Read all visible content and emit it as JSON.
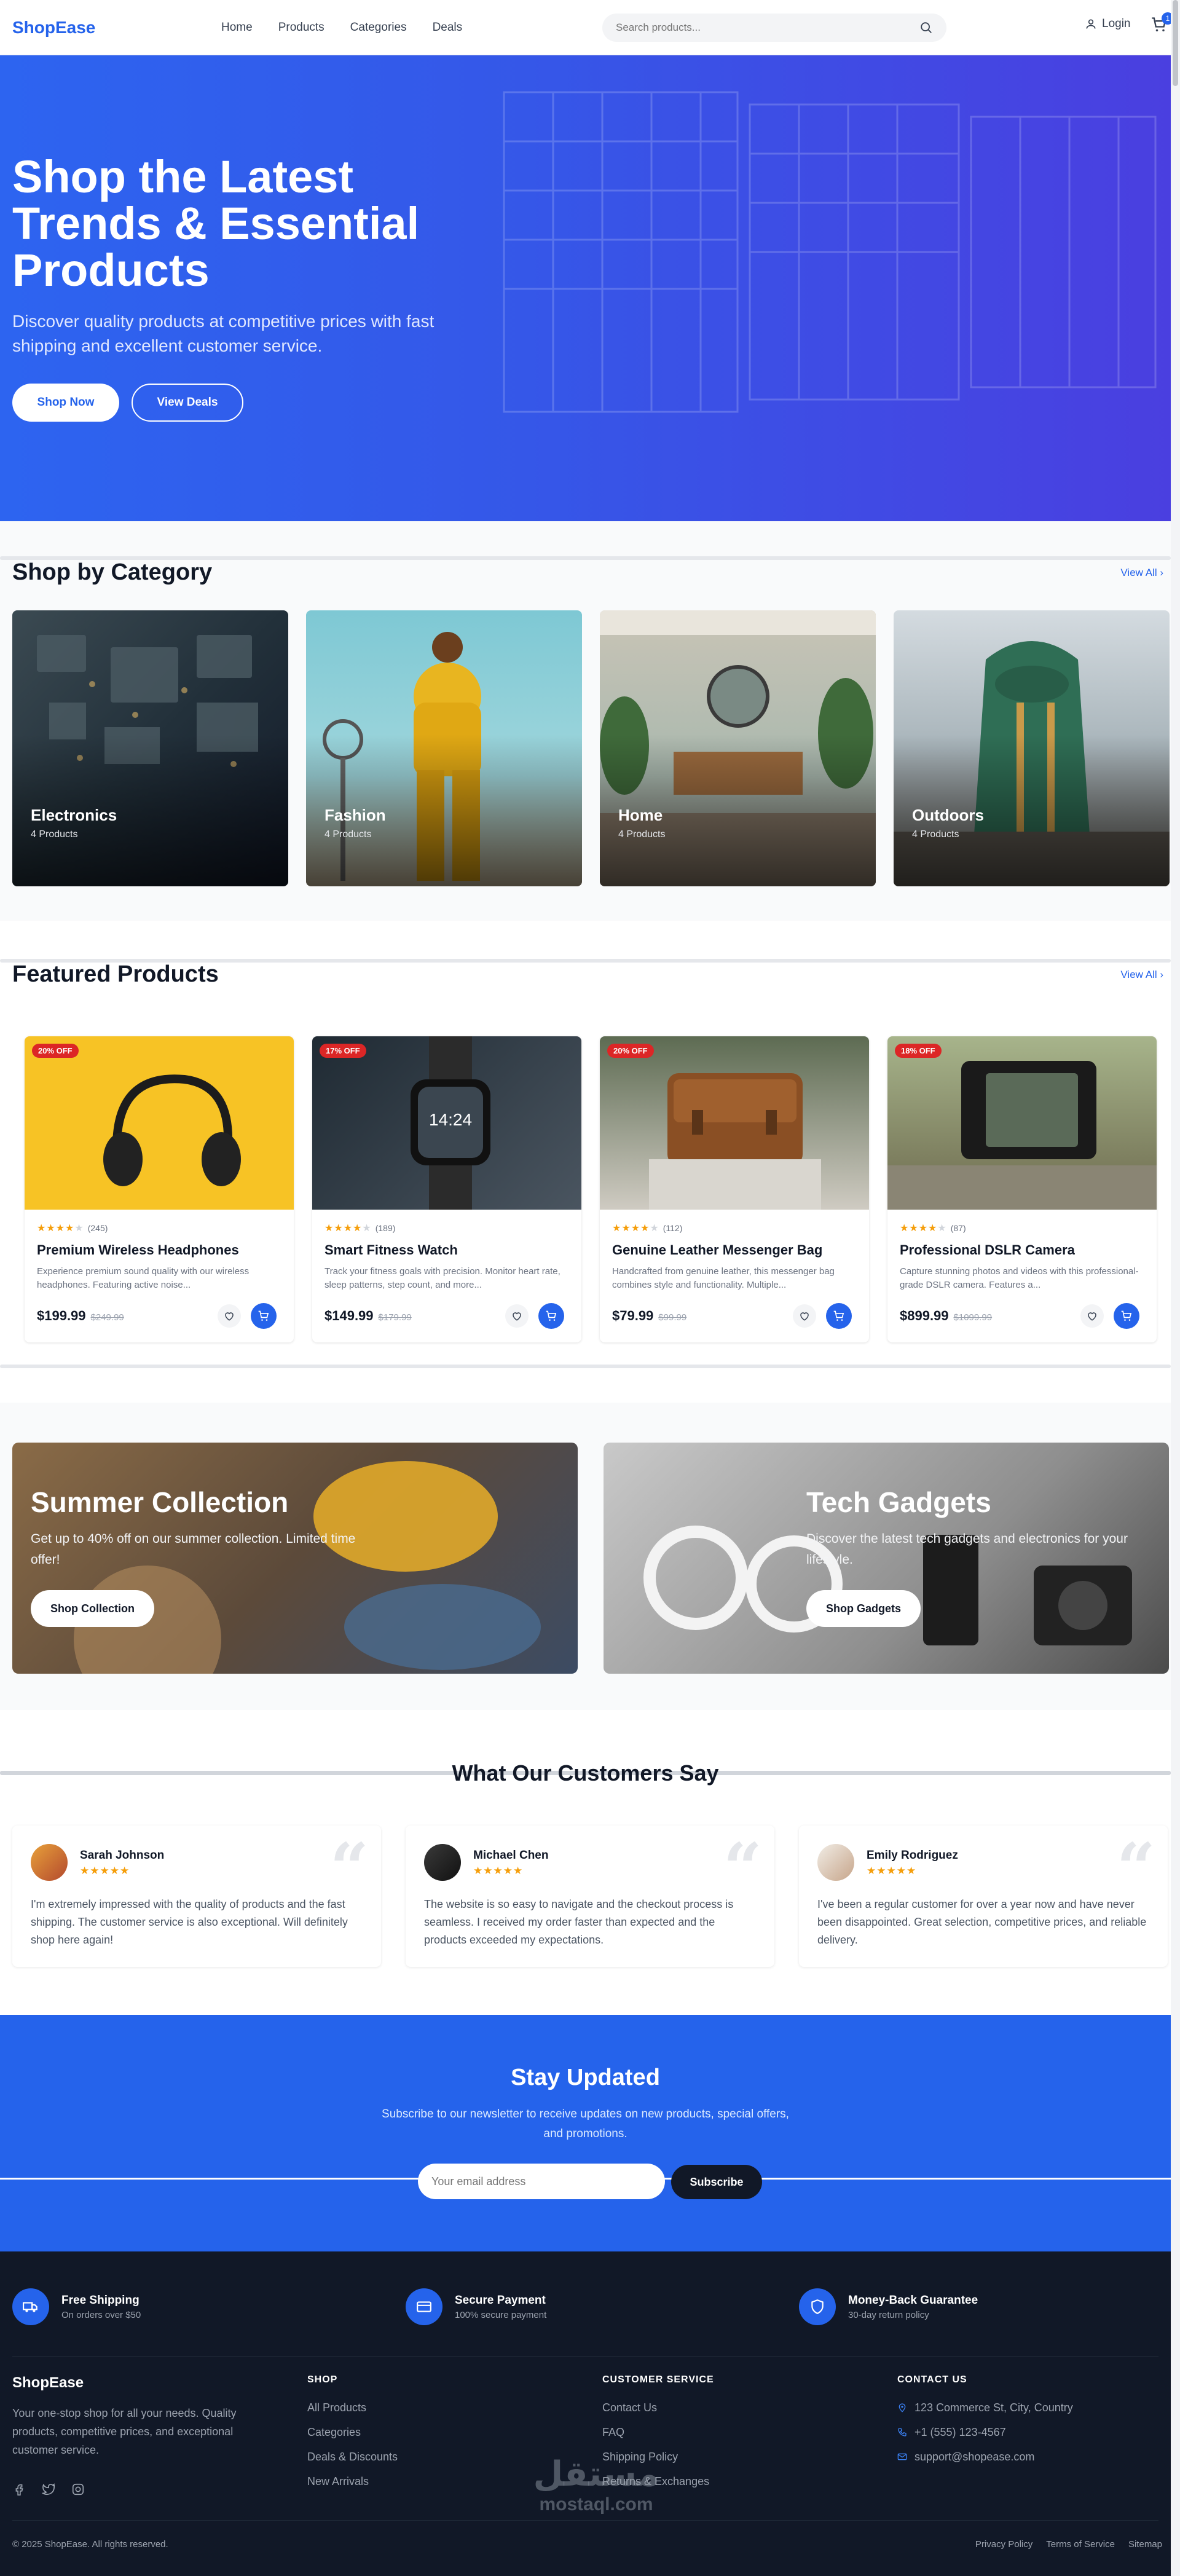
{
  "header": {
    "logo": "ShopEase",
    "nav": [
      "Home",
      "Products",
      "Categories",
      "Deals"
    ],
    "search_placeholder": "Search products...",
    "login": "Login",
    "cart_count": "1"
  },
  "hero": {
    "title": "Shop the Latest Trends & Essential Products",
    "subtitle": "Discover quality products at competitive prices with fast shipping and excellent customer service.",
    "primary_cta": "Shop Now",
    "secondary_cta": "View Deals"
  },
  "categories": {
    "title": "Shop by Category",
    "view_all": "View All",
    "items": [
      {
        "name": "Electronics",
        "count": "4 Products"
      },
      {
        "name": "Fashion",
        "count": "4 Products"
      },
      {
        "name": "Home",
        "count": "4 Products"
      },
      {
        "name": "Outdoors",
        "count": "4 Products"
      }
    ]
  },
  "featured": {
    "title": "Featured Products",
    "view_all": "View All",
    "products": [
      {
        "badge": "20% OFF",
        "stars": 4,
        "reviews": "(245)",
        "name": "Premium Wireless Headphones",
        "desc": "Experience premium sound quality with our wireless headphones. Featuring active noise...",
        "price": "$199.99",
        "old_price": "$249.99"
      },
      {
        "badge": "17% OFF",
        "stars": 4,
        "reviews": "(189)",
        "name": "Smart Fitness Watch",
        "desc": "Track your fitness goals with precision. Monitor heart rate, sleep patterns, step count, and more...",
        "price": "$149.99",
        "old_price": "$179.99"
      },
      {
        "badge": "20% OFF",
        "stars": 4,
        "reviews": "(112)",
        "name": "Genuine Leather Messenger Bag",
        "desc": "Handcrafted from genuine leather, this messenger bag combines style and functionality. Multiple...",
        "price": "$79.99",
        "old_price": "$99.99"
      },
      {
        "badge": "18% OFF",
        "stars": 4,
        "reviews": "(87)",
        "name": "Professional DSLR Camera",
        "desc": "Capture stunning photos and videos with this professional-grade DSLR camera. Features a...",
        "price": "$899.99",
        "old_price": "$1099.99"
      }
    ]
  },
  "promos": [
    {
      "title": "Summer Collection",
      "subtitle": "Get up to 40% off on our summer collection. Limited time offer!",
      "cta": "Shop Collection"
    },
    {
      "title": "Tech Gadgets",
      "subtitle": "Discover the latest tech gadgets and electronics for your lifestyle.",
      "cta": "Shop Gadgets"
    }
  ],
  "testimonials": {
    "title": "What Our Customers Say",
    "items": [
      {
        "name": "Sarah Johnson",
        "stars": "★★★★★",
        "text": "I'm extremely impressed with the quality of products and the fast shipping. The customer service is also exceptional. Will definitely shop here again!"
      },
      {
        "name": "Michael Chen",
        "stars": "★★★★★",
        "text": "The website is so easy to navigate and the checkout process is seamless. I received my order faster than expected and the products exceeded my expectations."
      },
      {
        "name": "Emily Rodriguez",
        "stars": "★★★★★",
        "text": "I've been a regular customer for over a year now and have never been disappointed. Great selection, competitive prices, and reliable delivery."
      }
    ]
  },
  "newsletter": {
    "title": "Stay Updated",
    "subtitle": "Subscribe to our newsletter to receive updates on new products, special offers, and promotions.",
    "placeholder": "Your email address",
    "button": "Subscribe"
  },
  "footer": {
    "features": [
      {
        "title": "Free Shipping",
        "sub": "On orders over $50"
      },
      {
        "title": "Secure Payment",
        "sub": "100% secure payment"
      },
      {
        "title": "Money-Back Guarantee",
        "sub": "30-day return policy"
      }
    ],
    "brand": "ShopEase",
    "brand_desc": "Your one-stop shop for all your needs. Quality products, competitive prices, and exceptional customer service.",
    "shop_title": "SHOP",
    "shop_links": [
      "All Products",
      "Categories",
      "Deals & Discounts",
      "New Arrivals"
    ],
    "service_title": "CUSTOMER SERVICE",
    "service_links": [
      "Contact Us",
      "FAQ",
      "Shipping Policy",
      "Returns & Exchanges"
    ],
    "contact_title": "CONTACT US",
    "address": "123 Commerce St, City, Country",
    "phone": "+1 (555) 123-4567",
    "email": "support@shopease.com",
    "copyright": "© 2025 ShopEase. All rights reserved.",
    "legal": [
      "Privacy Policy",
      "Terms of Service",
      "Sitemap"
    ],
    "watermark_ar": "مستقل",
    "watermark_lat": "mostaql.com"
  },
  "colors": {
    "primary": "#2563eb",
    "dark": "#111827",
    "badge": "#dc2626",
    "star": "#f59e0b"
  }
}
